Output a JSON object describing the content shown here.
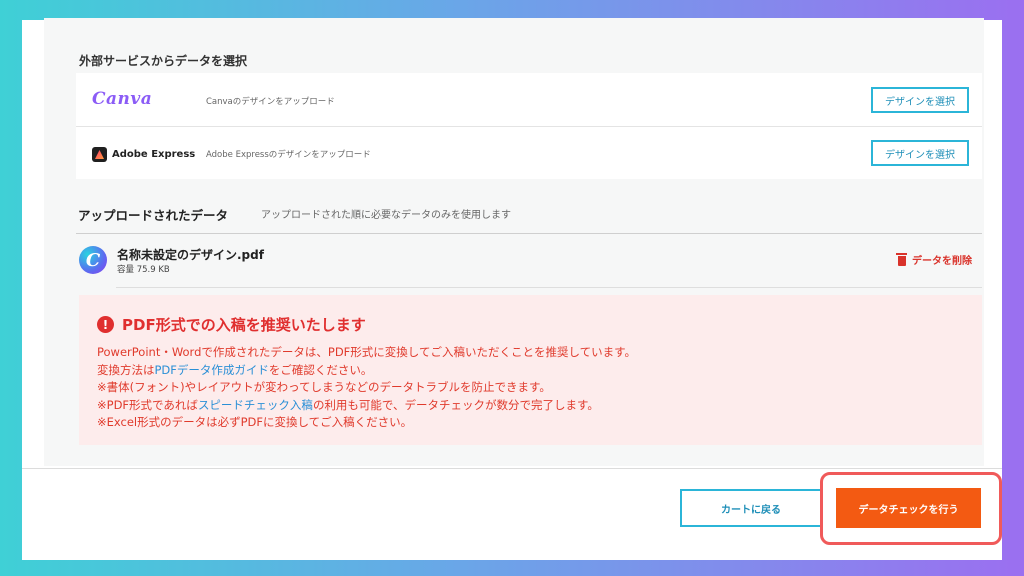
{
  "external": {
    "section_title": "外部サービスからデータを選択",
    "services": [
      {
        "logo_text": "Canva",
        "description": "Canvaのデザインをアップロード",
        "button_label": "デザインを選択"
      },
      {
        "logo_text": "Adobe Express",
        "description": "Adobe Expressのデザインをアップロード",
        "button_label": "デザインを選択"
      }
    ]
  },
  "uploaded": {
    "title": "アップロードされたデータ",
    "note": "アップロードされた順に必要なデータのみを使用します",
    "file": {
      "avatar_letter": "C",
      "name": "名称未設定のデザイン.pdf",
      "size": "容量 75.9 KB",
      "delete_label": "データを削除"
    }
  },
  "alert": {
    "icon": "!",
    "title": "PDF形式での入稿を推奨いたします",
    "line1": "PowerPoint・Wordで作成されたデータは、PDF形式に変換してご入稿いただくことを推奨しています。",
    "line2_pre": "変換方法は",
    "line2_link": "PDFデータ作成ガイド",
    "line2_post": "をご確認ください。",
    "line3": "※書体(フォント)やレイアウトが変わってしまうなどのデータトラブルを防止できます。",
    "line4_pre": "※PDF形式であれば",
    "line4_link": "スピードチェック入稿",
    "line4_post": "の利用も可能で、データチェックが数分で完了します。",
    "line5": "※Excel形式のデータは必ずPDFに変換してご入稿ください。"
  },
  "footer": {
    "back_label": "カートに戻る",
    "check_label": "データチェックを行う"
  },
  "colors": {
    "accent_blue": "#2bb5d8",
    "alert_red": "#e02f2f",
    "primary_orange": "#f35a12",
    "highlight": "#f05a5a"
  }
}
